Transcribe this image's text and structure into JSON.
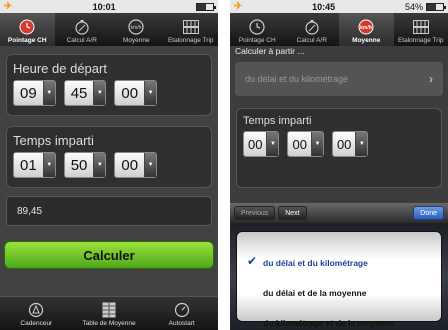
{
  "left": {
    "status": {
      "time": "10:01",
      "battery": "",
      "battery_level": 0.55
    },
    "tabs": [
      {
        "label": "Pointage CH",
        "icon": "clock-icon",
        "active": true
      },
      {
        "label": "Calcul A/R",
        "icon": "stopwatch-icon",
        "active": false
      },
      {
        "label": "Moyenne",
        "icon": "speed-icon",
        "active": false
      },
      {
        "label": "Etalonnage Trip",
        "icon": "counter-icon",
        "active": false
      }
    ],
    "depart": {
      "label": "Heure de départ",
      "values": [
        "09",
        "45",
        "00"
      ]
    },
    "imparti": {
      "label": "Temps imparti",
      "values": [
        "01",
        "50",
        "00"
      ]
    },
    "result_value": "89,45",
    "calc_button": "Calculer",
    "bottom_tabs": [
      {
        "label": "Cadenceur",
        "icon": "metronome-icon"
      },
      {
        "label": "Table de Moyenne",
        "icon": "table-icon"
      },
      {
        "label": "Autostart",
        "icon": "gauge-icon"
      }
    ]
  },
  "right": {
    "status": {
      "time": "10:45",
      "battery": "54%",
      "battery_level": 0.54
    },
    "tabs": [
      {
        "label": "Pointage CH",
        "icon": "clock-icon",
        "active": false
      },
      {
        "label": "Calcul A/R",
        "icon": "stopwatch-icon",
        "active": false
      },
      {
        "label": "Moyenne",
        "icon": "speed-icon",
        "active": true
      },
      {
        "label": "Etalonnage Trip",
        "icon": "counter-icon",
        "active": false
      }
    ],
    "calc_from": "Calculer à partir ...",
    "selected_mode": "du délai et du kilométrage",
    "imparti": {
      "label": "Temps imparti",
      "values": [
        "00",
        "00",
        "00"
      ]
    },
    "toolbar": {
      "previous": "Previous",
      "next": "Next",
      "done": "Done"
    },
    "options": [
      "du délai et du kilométrage",
      "du délai et de la moyenne",
      "du kilométrage et de la moyenne"
    ],
    "colors": {
      "accent_green": "#6cc22a",
      "done_blue": "#2b5fc0",
      "active_icon_red": "#d53a2e"
    }
  }
}
